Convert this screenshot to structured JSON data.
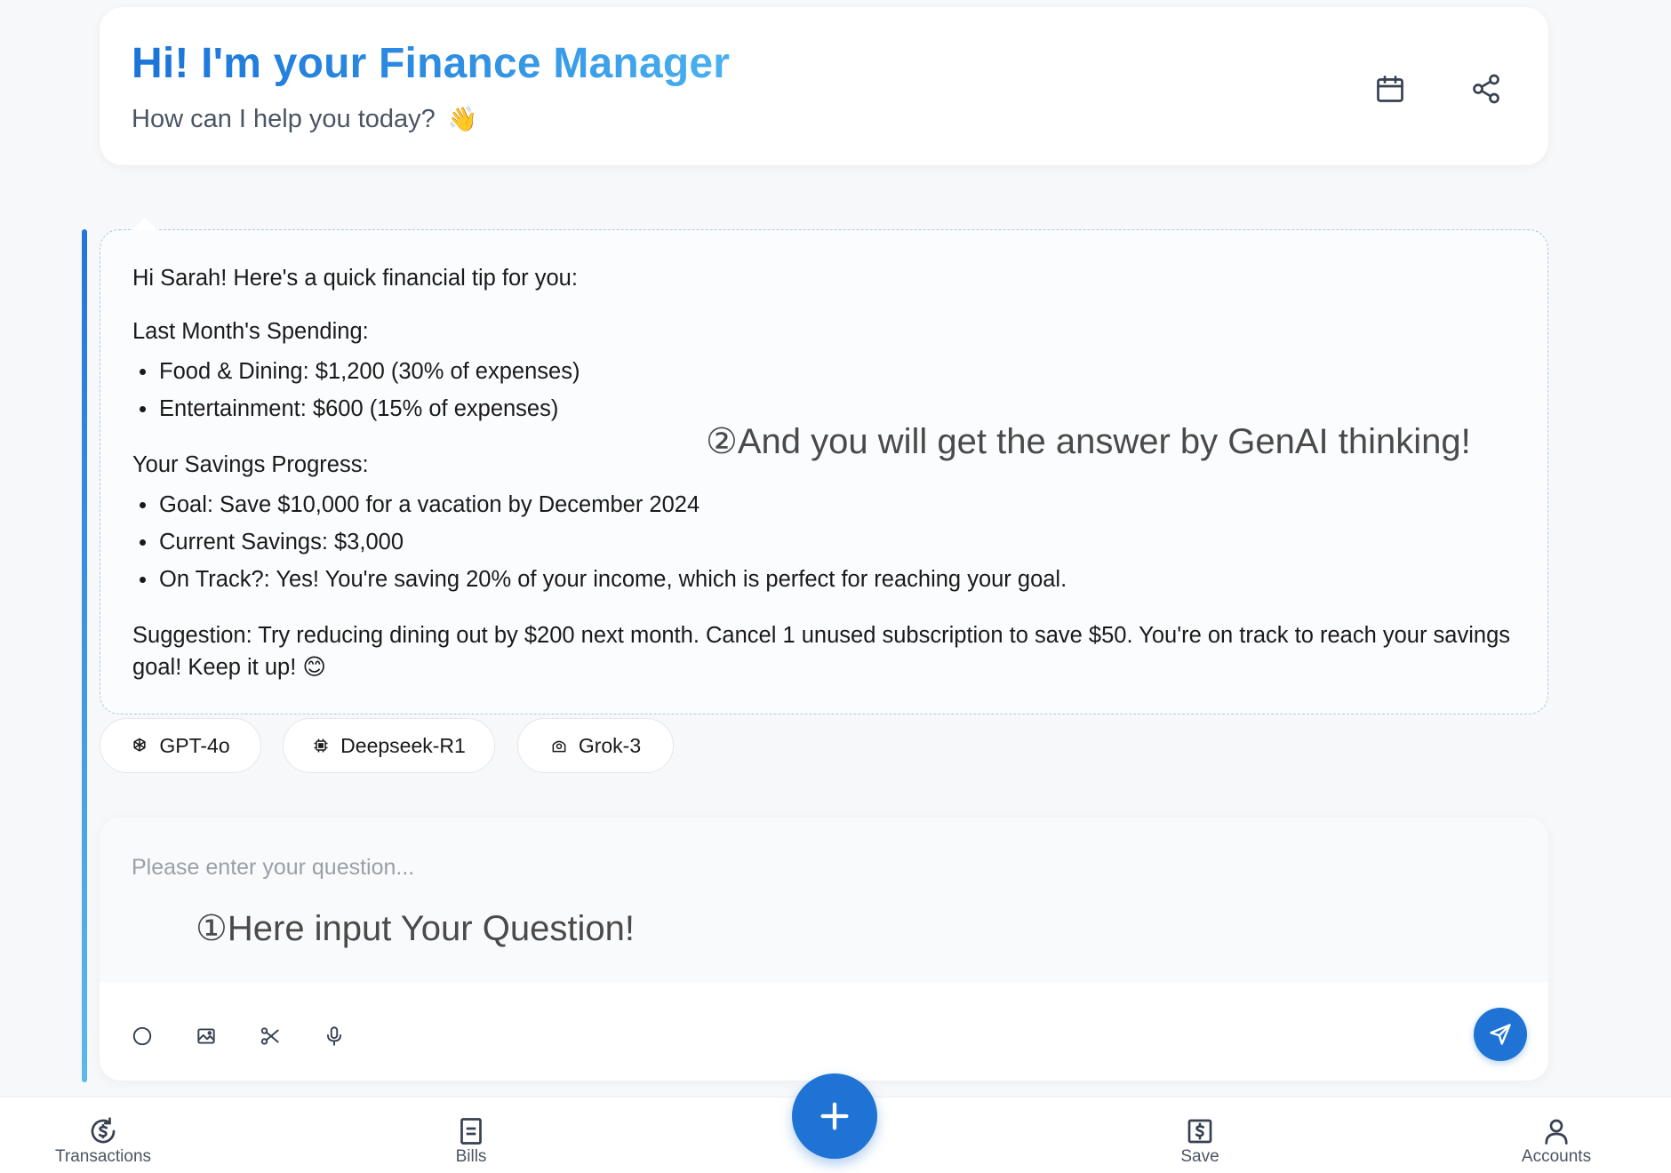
{
  "header": {
    "title": "Hi! I'm your Finance Manager",
    "subtitle": "How can I help you today?",
    "subtitle_emoji": "👋",
    "icons": {
      "calendar": "calendar-icon",
      "share": "share-icon"
    }
  },
  "answer": {
    "greeting": "Hi Sarah! Here's a quick financial tip for you:",
    "spending_heading": "Last Month's Spending:",
    "spending_items": [
      "Food & Dining: $1,200 (30% of expenses)",
      "Entertainment: $600 (15% of expenses)"
    ],
    "savings_heading": "Your Savings Progress:",
    "savings_items": [
      "Goal: Save $10,000 for a vacation by December 2024",
      "Current Savings: $3,000",
      "On Track?: Yes! You're saving 20% of your income, which is perfect for reaching your goal."
    ],
    "suggestion": "Suggestion: Try reducing dining out by $200 next month. Cancel 1 unused subscription to save $50. You're on track to reach your savings goal! Keep it up!",
    "suggestion_emoji": "😊",
    "overlay_note": "②And you will get the answer by GenAI thinking!"
  },
  "models": [
    {
      "label": "GPT-4o",
      "icon": "openai-icon"
    },
    {
      "label": "Deepseek-R1",
      "icon": "chip-icon"
    },
    {
      "label": "Grok-3",
      "icon": "robot-icon"
    }
  ],
  "input": {
    "placeholder": "Please enter your question...",
    "value": "",
    "overlay_note": "①Here input Your Question!",
    "tools": [
      "circle-icon",
      "image-icon",
      "scissors-icon",
      "microphone-icon"
    ],
    "send_icon": "send-icon"
  },
  "bottom_nav": {
    "items": [
      {
        "label": "Transactions",
        "icon": "transactions-icon"
      },
      {
        "label": "Bills",
        "icon": "bills-icon"
      },
      {
        "label": "Save",
        "icon": "save-dollar-icon"
      },
      {
        "label": "Accounts",
        "icon": "account-icon"
      }
    ],
    "fab_icon": "plus-icon"
  },
  "colors": {
    "accent": "#1f73d4",
    "title_gradient_start": "#1b74d8",
    "title_gradient_end": "#49b1ef",
    "background": "#f7f8fa",
    "card": "#ffffff"
  }
}
